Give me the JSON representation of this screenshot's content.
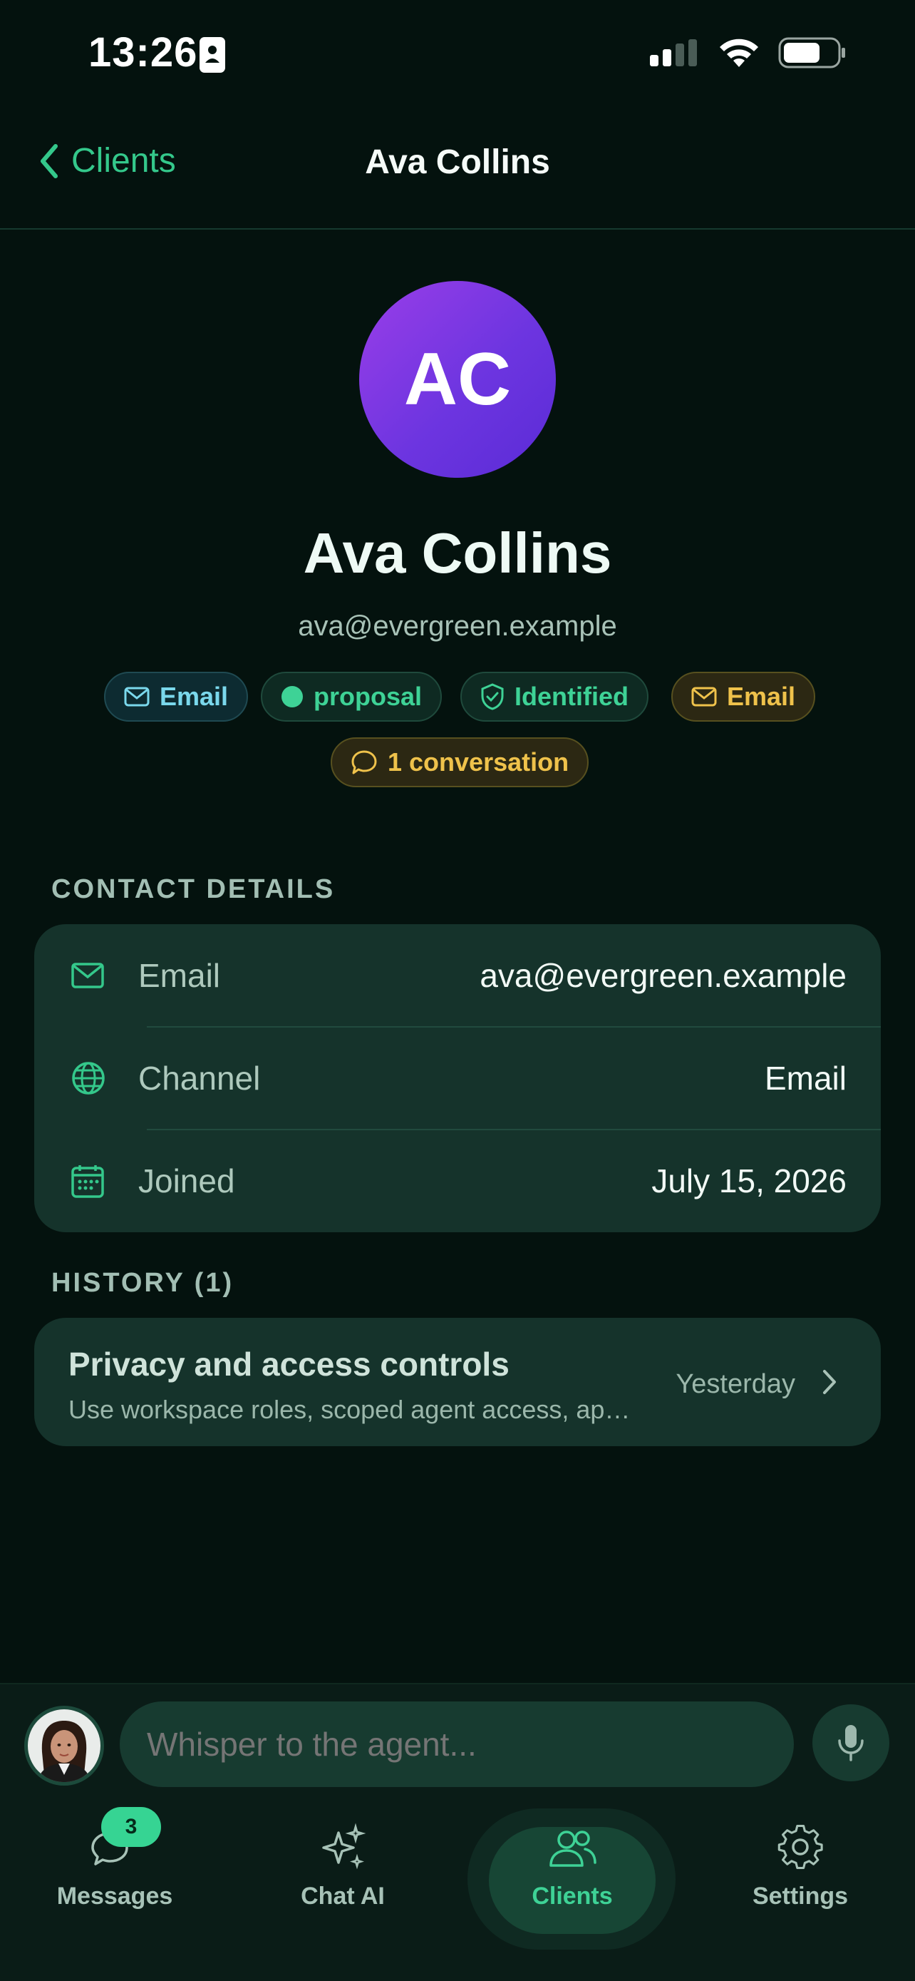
{
  "status_bar": {
    "time": "13:26"
  },
  "nav": {
    "back_label": "Clients",
    "title": "Ava Collins"
  },
  "profile": {
    "initials": "AC",
    "name": "Ava Collins",
    "email": "ava@evergreen.example",
    "chips": [
      {
        "label": "Email",
        "icon": "mail-icon",
        "style": "teal"
      },
      {
        "label": "proposal",
        "icon": "dot-icon",
        "style": "green"
      },
      {
        "label": "Identified",
        "icon": "shield-check-icon",
        "style": "green"
      },
      {
        "label": "Email",
        "icon": "mail-icon",
        "style": "amber"
      },
      {
        "label": "1 conversation",
        "icon": "chat-bubble-icon",
        "style": "amber"
      }
    ]
  },
  "contact": {
    "heading": "CONTACT DETAILS",
    "rows": [
      {
        "label": "Email",
        "value": "ava@evergreen.example",
        "icon": "mail-icon"
      },
      {
        "label": "Channel",
        "value": "Email",
        "icon": "globe-icon"
      },
      {
        "label": "Joined",
        "value": "July 15, 2026",
        "icon": "calendar-icon"
      }
    ]
  },
  "history": {
    "heading": "HISTORY (1)",
    "items": [
      {
        "title": "Privacy and access controls",
        "subtitle": "Use workspace roles, scoped agent access, ap…",
        "time": "Yesterday"
      }
    ]
  },
  "composer": {
    "placeholder": "Whisper to the agent..."
  },
  "tabs": [
    {
      "label": "Messages",
      "icon": "chat-bubbles-icon",
      "badge": "3"
    },
    {
      "label": "Chat AI",
      "icon": "sparkles-icon"
    },
    {
      "label": "Clients",
      "icon": "users-icon",
      "active": true
    },
    {
      "label": "Settings",
      "icon": "gear-icon"
    }
  ],
  "colors": {
    "accent": "#34c88b",
    "background": "#04120e",
    "card": "#15332b",
    "avatar_gradient_start": "#9a3ee8",
    "avatar_gradient_end": "#5a2bd6"
  }
}
